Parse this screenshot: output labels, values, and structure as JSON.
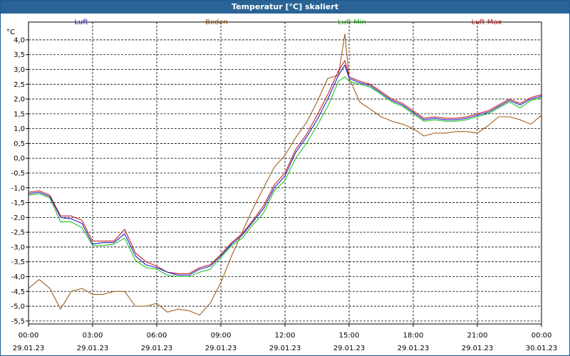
{
  "window": {
    "title": "Temperatur [°C] skaliert"
  },
  "chart_data": {
    "type": "line",
    "ylabel": "°C",
    "ylim": [
      -5.6,
      4.6
    ],
    "xlim": [
      0,
      24
    ],
    "grid": true,
    "legend_position": "top",
    "yticks": [
      -5.5,
      -5.0,
      -4.5,
      -4.0,
      -3.5,
      -3.0,
      -2.5,
      -2.0,
      -1.5,
      -1.0,
      -0.5,
      0.0,
      0.5,
      1.0,
      1.5,
      2.0,
      2.5,
      3.0,
      3.5,
      4.0
    ],
    "ytick_labels": [
      "-5,5",
      "-5,0",
      "-4,5",
      "-4,0",
      "-3,5",
      "-3,0",
      "-2,5",
      "-2,0",
      "-1,5",
      "-1,0",
      "-0,5",
      "0,0",
      "0,5",
      "1,0",
      "1,5",
      "2,0",
      "2,5",
      "3,0",
      "3,5",
      "4,0"
    ],
    "xticks": [
      {
        "x": 0,
        "time": "00:00",
        "date": "29.01.23"
      },
      {
        "x": 3,
        "time": "03:00",
        "date": "29.01.23"
      },
      {
        "x": 6,
        "time": "06:00",
        "date": "29.01.23"
      },
      {
        "x": 9,
        "time": "09:00",
        "date": "29.01.23"
      },
      {
        "x": 12,
        "time": "12:00",
        "date": "29.01.23"
      },
      {
        "x": 15,
        "time": "15:00",
        "date": "29.01.23"
      },
      {
        "x": 18,
        "time": "18:00",
        "date": "29.01.23"
      },
      {
        "x": 21,
        "time": "21:00",
        "date": "29.01.23"
      },
      {
        "x": 24,
        "time": "00:00",
        "date": "30.01.23"
      }
    ],
    "x": [
      0,
      0.5,
      1,
      1.5,
      2,
      2.5,
      3,
      3.5,
      4,
      4.5,
      5,
      5.5,
      6,
      6.5,
      7,
      7.5,
      8,
      8.5,
      9,
      9.5,
      10,
      10.5,
      11,
      11.5,
      12,
      12.5,
      13,
      13.5,
      14,
      14.5,
      14.8,
      15,
      15.5,
      16,
      16.5,
      17,
      17.5,
      18,
      18.5,
      19,
      19.5,
      20,
      20.5,
      21,
      21.5,
      22,
      22.5,
      23,
      23.5,
      24
    ],
    "series": [
      {
        "name": "Luft",
        "color": "#1f1fcc",
        "values": [
          -1.2,
          -1.15,
          -1.3,
          -2.0,
          -2.05,
          -2.2,
          -2.9,
          -2.85,
          -2.85,
          -2.55,
          -3.3,
          -3.6,
          -3.7,
          -3.85,
          -3.95,
          -3.95,
          -3.75,
          -3.65,
          -3.3,
          -2.9,
          -2.6,
          -2.15,
          -1.7,
          -1.0,
          -0.6,
          0.2,
          0.7,
          1.3,
          2.0,
          2.8,
          3.15,
          2.7,
          2.55,
          2.45,
          2.2,
          1.95,
          1.8,
          1.55,
          1.3,
          1.35,
          1.3,
          1.3,
          1.35,
          1.45,
          1.55,
          1.75,
          1.95,
          1.8,
          2.0,
          2.1
        ]
      },
      {
        "name": "Boden",
        "color": "#a0601e",
        "values": [
          -4.4,
          -4.1,
          -4.4,
          -5.1,
          -4.5,
          -4.4,
          -4.6,
          -4.6,
          -4.5,
          -4.5,
          -5.0,
          -5.0,
          -4.9,
          -5.2,
          -5.1,
          -5.15,
          -5.3,
          -4.9,
          -4.2,
          -3.3,
          -2.5,
          -1.7,
          -1.0,
          -0.3,
          0.1,
          0.7,
          1.2,
          1.9,
          2.7,
          2.8,
          4.2,
          2.7,
          1.9,
          1.65,
          1.4,
          1.25,
          1.15,
          1.0,
          0.75,
          0.85,
          0.85,
          0.9,
          0.9,
          0.85,
          1.1,
          1.4,
          1.4,
          1.3,
          1.15,
          1.45
        ]
      },
      {
        "name": "Luft Min",
        "color": "#1fc41f",
        "values": [
          -1.25,
          -1.2,
          -1.35,
          -2.15,
          -2.15,
          -2.35,
          -2.95,
          -2.95,
          -2.9,
          -2.7,
          -3.45,
          -3.7,
          -3.75,
          -3.95,
          -4.0,
          -4.0,
          -3.85,
          -3.75,
          -3.35,
          -2.95,
          -2.7,
          -2.25,
          -1.85,
          -1.1,
          -0.75,
          0.0,
          0.5,
          1.1,
          1.75,
          2.6,
          2.75,
          2.6,
          2.5,
          2.4,
          2.15,
          1.9,
          1.75,
          1.5,
          1.25,
          1.3,
          1.25,
          1.25,
          1.3,
          1.4,
          1.5,
          1.7,
          1.9,
          1.7,
          1.95,
          2.05
        ]
      },
      {
        "name": "Luft Max",
        "color": "#c81e1e",
        "values": [
          -1.15,
          -1.1,
          -1.25,
          -1.95,
          -1.95,
          -2.1,
          -2.8,
          -2.8,
          -2.8,
          -2.4,
          -3.2,
          -3.5,
          -3.65,
          -3.85,
          -3.9,
          -3.9,
          -3.7,
          -3.6,
          -3.25,
          -2.85,
          -2.55,
          -2.1,
          -1.6,
          -0.9,
          -0.5,
          0.3,
          0.8,
          1.45,
          2.15,
          2.95,
          3.3,
          2.75,
          2.6,
          2.5,
          2.25,
          2.0,
          1.85,
          1.6,
          1.35,
          1.4,
          1.35,
          1.35,
          1.4,
          1.5,
          1.6,
          1.8,
          2.0,
          1.85,
          2.05,
          2.15
        ]
      }
    ]
  }
}
